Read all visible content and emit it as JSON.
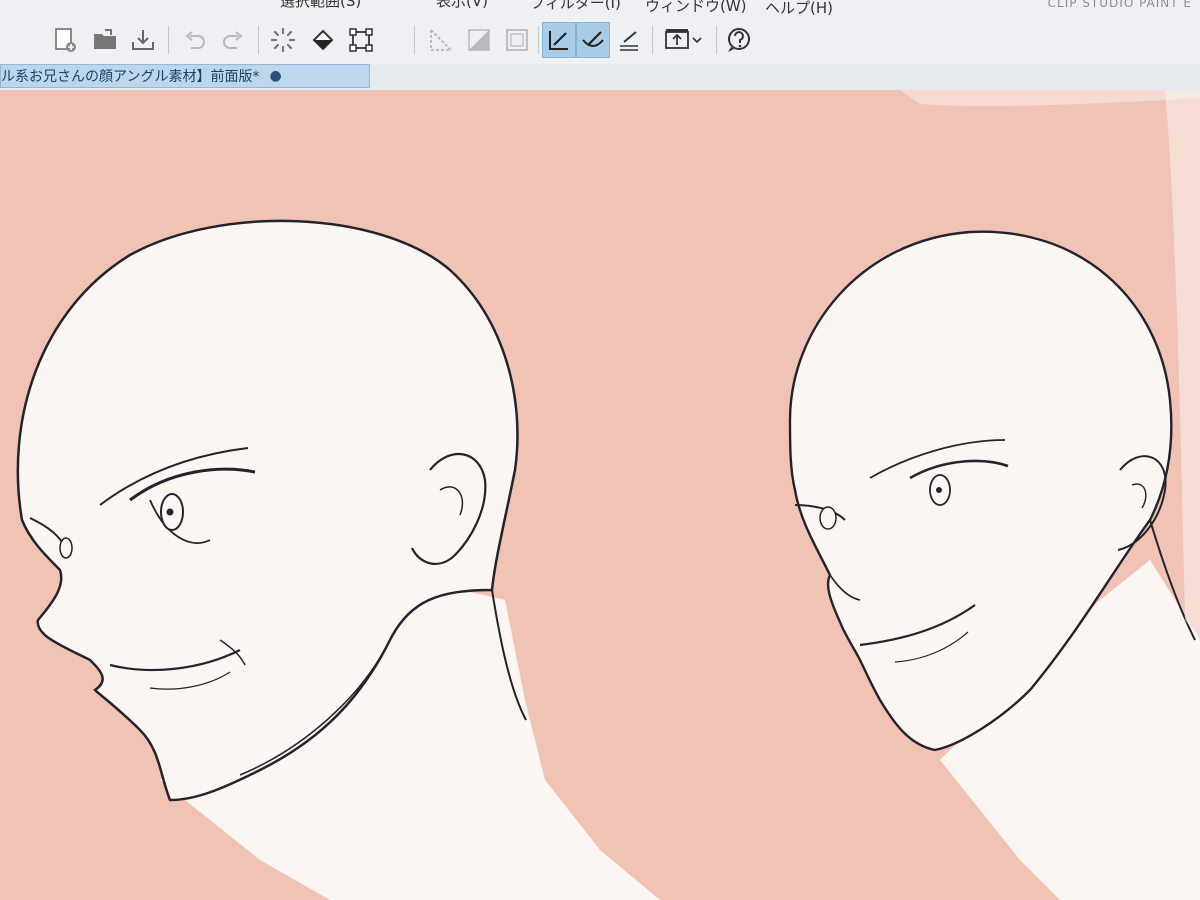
{
  "menu": {
    "items": [
      {
        "label": "選択範囲(S)"
      },
      {
        "label": "表示(V)"
      },
      {
        "label": "フィルター(I)"
      },
      {
        "label": "ウィンドウ(W)"
      },
      {
        "label": "ヘルプ(H)"
      }
    ],
    "brand": "CLIP STUDIO PAINT E"
  },
  "toolbar": {
    "buttons": [
      {
        "icon": "new-canvas-icon"
      },
      {
        "icon": "open-folder-icon"
      },
      {
        "icon": "save-icon"
      },
      {
        "icon": "undo-icon"
      },
      {
        "icon": "redo-icon"
      },
      {
        "icon": "loading-spinner-icon"
      },
      {
        "icon": "fill-icon"
      },
      {
        "icon": "transform-icon"
      },
      {
        "icon": "ruler-icon"
      },
      {
        "icon": "tone-icon"
      },
      {
        "icon": "frame-icon"
      },
      {
        "icon": "snap-to-ruler-icon"
      },
      {
        "icon": "snap-to-special-ruler-icon"
      },
      {
        "icon": "snap-to-grid-icon"
      },
      {
        "icon": "canvas-settings-icon"
      },
      {
        "icon": "help-icon"
      }
    ]
  },
  "document": {
    "tab_title": "ル系お兄さんの顔アングル素材】前面版*",
    "modified_marker": "●"
  },
  "colors": {
    "canvas_bg": "#f1c3b5",
    "skin": "#fbf6f2",
    "line": "#23232b",
    "toolbar_bg": "#eef0f3",
    "active_tab": "#bcd7ec"
  }
}
